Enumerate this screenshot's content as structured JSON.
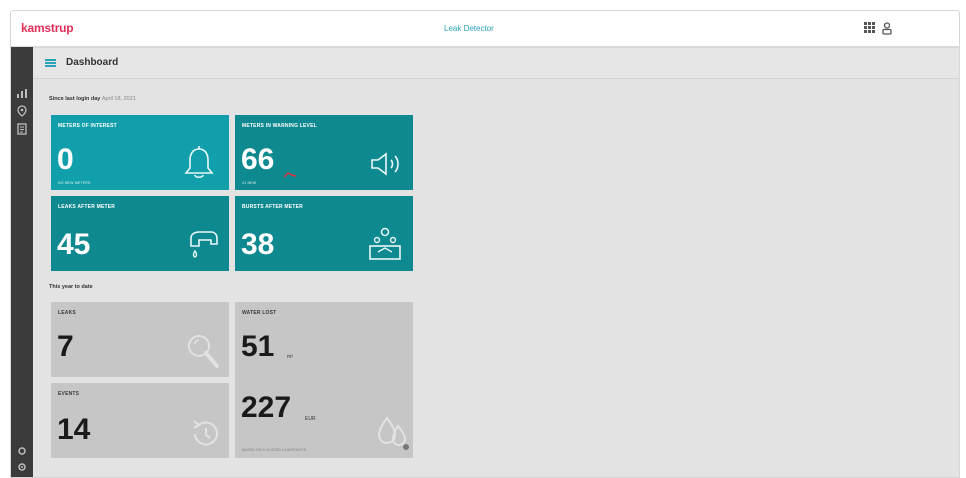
{
  "header": {
    "logo": "kamstrup",
    "app_title": "Leak Detector",
    "icons": [
      "apps-grid-icon",
      "user-icon"
    ]
  },
  "sidebar": {
    "top_icons": [
      "analytics-icon",
      "map-pin-icon",
      "report-icon"
    ],
    "bottom_icons": [
      "settings-icon",
      "logout-icon"
    ]
  },
  "subheader": {
    "menu_icon": "hamburger-icon",
    "title": "Dashboard"
  },
  "since_last_login": {
    "label": "Since last login day",
    "date": "April 18, 2021"
  },
  "tiles_since": [
    {
      "label": "Meters of interest",
      "value": "0",
      "sub": "NO NEW METERS",
      "icon": "bell-icon",
      "color": "#11a0ab"
    },
    {
      "label": "Meters in warning level",
      "value": "66",
      "sub": "41 NEW",
      "icon": "speaker-icon",
      "color": "#0e8990",
      "trend_color": "#d9343f"
    },
    {
      "label": "Leaks after meter",
      "value": "45",
      "icon": "faucet-drip-icon",
      "color": "#0e8990"
    },
    {
      "label": "Bursts after meter",
      "value": "38",
      "icon": "burst-pipe-icon",
      "color": "#0e8990"
    }
  ],
  "year_to_date": {
    "label": "This year to date"
  },
  "tiles_ytd": [
    {
      "label": "Leaks",
      "value": "7",
      "icon": "magnifier-icon"
    },
    {
      "label": "Events",
      "value": "14",
      "icon": "history-icon"
    },
    {
      "label": "Water lost",
      "value": "51",
      "unit": "m³"
    },
    {
      "value": "227",
      "unit": "EUR",
      "note": "BASED ON 9 GUIDED LEAKPOINTS",
      "icon": "water-drops-icon"
    }
  ]
}
